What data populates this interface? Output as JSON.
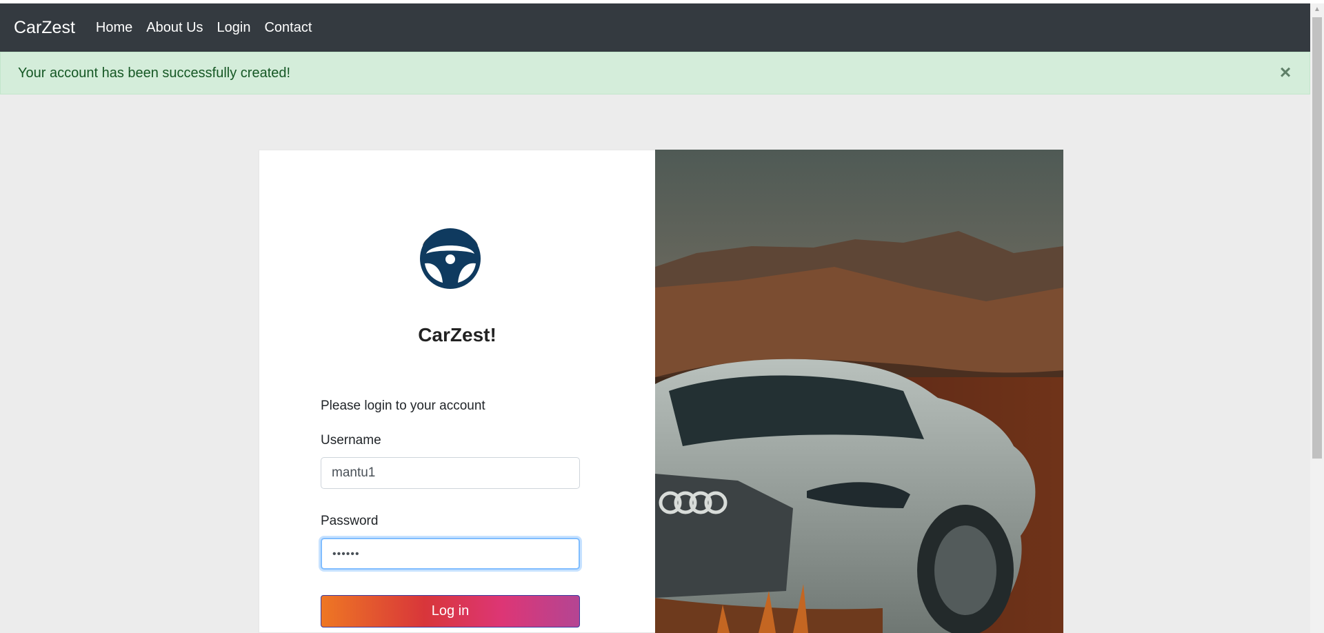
{
  "navbar": {
    "brand": "CarZest",
    "links": [
      "Home",
      "About Us",
      "Login",
      "Contact"
    ]
  },
  "alert": {
    "message": "Your account has been successfully created!",
    "close_glyph": "×"
  },
  "login": {
    "logo_title": "CarZest!",
    "subtitle": "Please login to your account",
    "username_label": "Username",
    "username_value": "mantu1",
    "password_label": "Password",
    "password_value": "••••••",
    "button_label": "Log in"
  },
  "colors": {
    "navbar": "#343a40",
    "alert_bg": "#d4edda",
    "alert_text": "#155724",
    "logo": "#0f3a5f",
    "button_gradient": [
      "#ee7724",
      "#d8363a",
      "#dd3675",
      "#b44593"
    ]
  },
  "icons": {
    "logo": "steering-wheel-icon",
    "hero": "car-photo"
  }
}
